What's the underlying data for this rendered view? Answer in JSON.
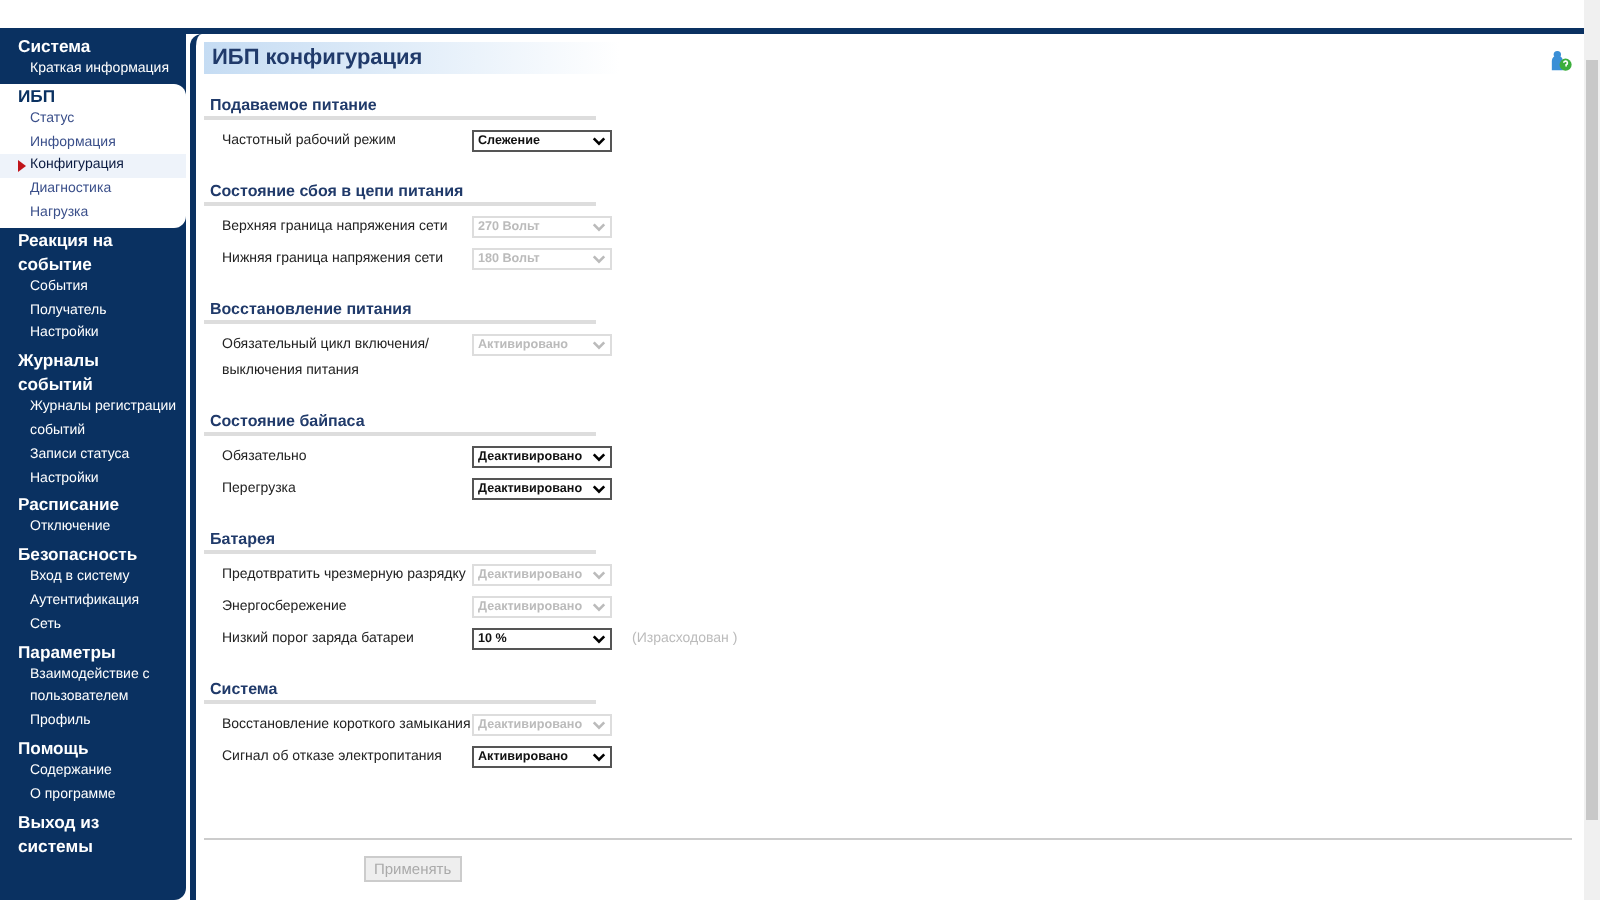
{
  "sidebar": {
    "groups": [
      {
        "title": "Система",
        "expanded": false,
        "items": [
          {
            "label": "Краткая информация",
            "selected": false
          }
        ]
      },
      {
        "title": "ИБП",
        "expanded": true,
        "items": [
          {
            "label": "Статус",
            "selected": false
          },
          {
            "label": "Информация",
            "selected": false
          },
          {
            "label": "Конфигурация",
            "selected": true
          },
          {
            "label": "Диагностика",
            "selected": false
          },
          {
            "label": "Нагрузка",
            "selected": false
          }
        ]
      },
      {
        "title": "Реакция на событие",
        "expanded": false,
        "items": [
          {
            "label": "События",
            "selected": false
          },
          {
            "label": "Получатель",
            "selected": false
          },
          {
            "label": "Настройки",
            "selected": false
          }
        ]
      },
      {
        "title": "Журналы событий",
        "expanded": false,
        "items": [
          {
            "label": "Журналы регистрации событий",
            "selected": false
          },
          {
            "label": "Записи статуса",
            "selected": false
          },
          {
            "label": "Настройки",
            "selected": false
          }
        ]
      },
      {
        "title": "Расписание",
        "expanded": false,
        "items": [
          {
            "label": "Отключение",
            "selected": false
          }
        ]
      },
      {
        "title": "Безопасность",
        "expanded": false,
        "items": [
          {
            "label": "Вход в систему",
            "selected": false
          },
          {
            "label": "Аутентификация",
            "selected": false
          },
          {
            "label": "Сеть",
            "selected": false
          }
        ]
      },
      {
        "title": "Параметры",
        "expanded": false,
        "items": [
          {
            "label": "Взаимодействие с пользователем",
            "selected": false
          },
          {
            "label": "Профиль",
            "selected": false
          }
        ]
      },
      {
        "title": "Помощь",
        "expanded": false,
        "items": [
          {
            "label": "Содержание",
            "selected": false
          },
          {
            "label": "О программе",
            "selected": false
          }
        ]
      },
      {
        "title": "Выход из системы",
        "expanded": false
      }
    ]
  },
  "page": {
    "title": "ИБП конфигурация",
    "sections": [
      {
        "heading": "Подаваемое питание",
        "rows": [
          {
            "label": "Частотный рабочий режим",
            "value": "Слежение",
            "disabled": false
          }
        ]
      },
      {
        "heading": "Состояние сбоя в цепи питания",
        "rows": [
          {
            "label": "Верхняя граница напряжения сети",
            "value": "270 Вольт",
            "disabled": true
          },
          {
            "label": "Нижняя граница напряжения сети",
            "value": "180 Вольт",
            "disabled": true
          }
        ]
      },
      {
        "heading": "Восстановление питания",
        "rows": [
          {
            "label": "Обязательный цикл включения/ выключения питания",
            "value": "Активировано",
            "disabled": true
          }
        ]
      },
      {
        "heading": "Состояние байпаса",
        "rows": [
          {
            "label": "Обязательно",
            "value": "Деактивировано",
            "disabled": false
          },
          {
            "label": "Перегрузка",
            "value": "Деактивировано",
            "disabled": false
          }
        ]
      },
      {
        "heading": "Батарея",
        "rows": [
          {
            "label": "Предотвратить чрезмерную разрядку",
            "value": "Деактивировано",
            "disabled": true
          },
          {
            "label": "Энергосбережение",
            "value": "Деактивировано",
            "disabled": true
          },
          {
            "label": "Низкий порог заряда батареи",
            "value": "10 %",
            "disabled": false,
            "note": "(Израсходован )"
          }
        ]
      },
      {
        "heading": "Система",
        "rows": [
          {
            "label": "Восстановление короткого замыкания",
            "value": "Деактивировано",
            "disabled": true
          },
          {
            "label": "Сигнал об отказе электропитания",
            "value": "Активировано",
            "disabled": false
          }
        ]
      }
    ],
    "apply_button": {
      "label": "Применять",
      "disabled": true
    }
  }
}
